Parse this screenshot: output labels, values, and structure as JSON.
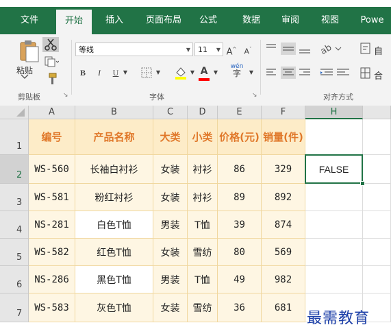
{
  "ribbon_tabs": [
    {
      "label": "文件"
    },
    {
      "label": "开始",
      "active": true
    },
    {
      "label": "插入"
    },
    {
      "label": "页面布局"
    },
    {
      "label": "公式"
    },
    {
      "label": "数据"
    },
    {
      "label": "审阅"
    },
    {
      "label": "视图"
    },
    {
      "label": "Powe"
    }
  ],
  "clipboard": {
    "paste_label": "粘贴",
    "group_label": "剪贴板",
    "icons": [
      "paste-icon",
      "cut-icon",
      "copy-icon",
      "format-painter-icon"
    ]
  },
  "font": {
    "name": "等线",
    "size": "11",
    "grow": "A",
    "shrink": "A",
    "bold": "B",
    "italic": "I",
    "underline": "U",
    "font_color": "A",
    "phonetic": "wén",
    "group_label": "字体",
    "fill_color": "#ffff00",
    "text_color": "#ff0000"
  },
  "alignment": {
    "group_label": "对齐方式",
    "wrap_label": "自",
    "merge_label": "合"
  },
  "columns": [
    "A",
    "B",
    "C",
    "D",
    "E",
    "F",
    "H"
  ],
  "rows": [
    "1",
    "2",
    "3",
    "4",
    "5",
    "6",
    "7"
  ],
  "header": [
    "编号",
    "产品名称",
    "大类",
    "小类",
    "价格(元)",
    "销量(件)"
  ],
  "header_lines": {
    "price_1": "价格",
    "price_2": "(元)",
    "qty_1": "销量",
    "qty_2": "(件)"
  },
  "table": [
    [
      "WS-560",
      "长袖白衬衫",
      "女装",
      "衬衫",
      "86",
      "329"
    ],
    [
      "WS-581",
      "粉红衬衫",
      "女装",
      "衬衫",
      "89",
      "892"
    ],
    [
      "NS-281",
      "白色T恤",
      "男装",
      "T恤",
      "39",
      "874"
    ],
    [
      "WS-582",
      "红色T恤",
      "女装",
      "雪纺",
      "80",
      "569"
    ],
    [
      "NS-286",
      "黑色T恤",
      "男装",
      "T恤",
      "49",
      "982"
    ],
    [
      "WS-583",
      "灰色T恤",
      "女装",
      "雪纺",
      "36",
      "681"
    ]
  ],
  "h2_value": "FALSE",
  "watermark": "最需教育",
  "colors": {
    "accent": "#217346",
    "header_fill": "#fdecc8",
    "header_text": "#e0782a",
    "body_fill": "#fef6e3",
    "border": "#f0d79e"
  }
}
